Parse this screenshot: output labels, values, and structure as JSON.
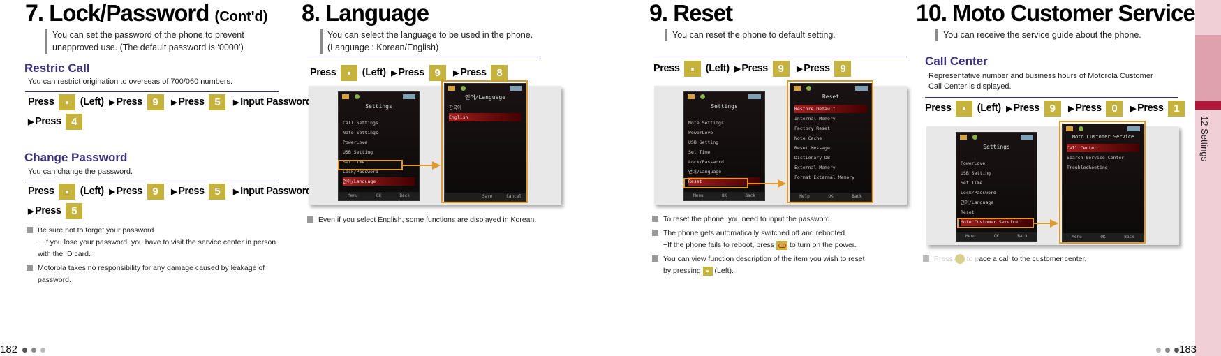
{
  "left_page": {
    "section7": {
      "number": "7",
      "title": "Lock/Password",
      "contd": "(Cont'd)",
      "intro": "You can set the password of the phone to prevent unapproved use. (The default password is ‘0000’)",
      "restric_call": {
        "title": "Restric Call",
        "desc": "You can restrict origination to overseas of 700/060 numbers.",
        "steps": [
          "Press",
          "(Left)",
          "Press",
          "Press",
          "Input Password",
          "Press"
        ],
        "keys": [
          "left-soft-key",
          "9-wxyz-key",
          "5-jkl-key",
          "4-ghi-key"
        ]
      },
      "change_password": {
        "title": "Change Password",
        "desc": "You can change the password.",
        "steps": [
          "Press",
          "(Left)",
          "Press",
          "Press",
          "Input Password",
          "Press"
        ],
        "keys": [
          "left-soft-key",
          "9-wxyz-key",
          "5-jkl-key",
          "5-jkl-key"
        ]
      },
      "notes": [
        "Be sure not to forget your password.",
        "− If you lose your password, you have to visit the service center in person with the ID card.",
        "Motorola takes no responsibility for any damage caused by leakage of password."
      ]
    },
    "section8": {
      "number": "8",
      "title": "Language",
      "intro_line1": "You can select the language to be used in the phone.",
      "intro_line2": "(Language : Korean/English)",
      "steps": [
        "Press",
        "(Left)",
        "Press",
        "Press"
      ],
      "keys": [
        "left-soft-key",
        "9-wxyz-key",
        "8-tuv-key"
      ],
      "screen1": {
        "header": "Settings",
        "items": [
          "Call Settings",
          "Note Settings",
          "PowerLove",
          "USB Setting",
          "Set Time",
          "Lock/Password",
          "언어/Language"
        ],
        "selected": "언어/Language",
        "softkeys": [
          "Menu",
          "OK",
          "Back"
        ]
      },
      "screen2": {
        "header": "언어/Language",
        "items": [
          "한국어",
          "English"
        ],
        "selected": "English",
        "softkeys": [
          "Save",
          "Cancel"
        ]
      },
      "note": "Even if you select English, some functions are displayed in Korean."
    },
    "page_number": "182"
  },
  "right_page": {
    "section9": {
      "number": "9",
      "title": "Reset",
      "intro": "You can reset the phone to default setting.",
      "steps": [
        "Press",
        "(Left)",
        "Press",
        "Press"
      ],
      "keys": [
        "left-soft-key",
        "9-wxyz-key",
        "9-wxyz-key"
      ],
      "screen1": {
        "header": "Settings",
        "items": [
          "Note Settings",
          "PowerLove",
          "USB Setting",
          "Set Time",
          "Lock/Password",
          "언어/Language",
          "Reset"
        ],
        "selected": "Reset",
        "softkeys": [
          "Menu",
          "OK",
          "Back"
        ]
      },
      "screen2": {
        "header": "Reset",
        "items": [
          "Restore Default",
          "Internal Memory",
          "Factory Reset",
          "Note Cache",
          "Reset Message",
          "Dictionary DB",
          "External Memory",
          "Format External Memory"
        ],
        "selected": "Restore Default",
        "softkeys": [
          "Help",
          "OK",
          "Back"
        ]
      },
      "notes": [
        "To reset the phone, you need to input the password.",
        "The phone gets automatically switched off and rebooted.",
        "−If the phone fails to reboot, press",
        "to turn on the power.",
        "You can view function description of the item you wish to reset",
        "by pressing",
        "(Left)."
      ]
    },
    "section10": {
      "number": "10",
      "title": "Moto Customer Service",
      "intro": "You can receive the service guide about the phone.",
      "call_center": {
        "title": "Call Center",
        "desc_line1": "Representative number and business hours of Motorola Customer",
        "desc_line2": "Call Center is displayed.",
        "steps": [
          "Press",
          "(Left)",
          "Press",
          "Press",
          "Press"
        ],
        "keys": [
          "left-soft-key",
          "9-wxyz-key",
          "0-key",
          "1-key"
        ]
      },
      "screen1": {
        "header": "Settings",
        "items": [
          "PowerLove",
          "USB Setting",
          "Set Time",
          "Lock/Password",
          "언어/Language",
          "Reset",
          "Moto Customer Service"
        ],
        "selected": "Moto Customer Service",
        "softkeys": [
          "Menu",
          "OK",
          "Back"
        ]
      },
      "screen2": {
        "header": "Moto Customer Service",
        "items": [
          "Call Center",
          "Search Service Center",
          "Troubleshooting"
        ],
        "selected": "Call Center",
        "softkeys": [
          "Menu",
          "OK",
          "Back"
        ]
      },
      "note_prefix": "Press",
      "note_mid": "to p",
      "note_rest": "ace a call to the customer center."
    },
    "page_number": "183",
    "side_tab": "12 Settings"
  },
  "colors": {
    "accent_purple": "#3a2f7c",
    "key_gold": "#c6b33d",
    "highlight_orange": "#e09a2a",
    "side_tab_pink": "#f0d0d6",
    "side_tab_red": "#b5173a"
  }
}
